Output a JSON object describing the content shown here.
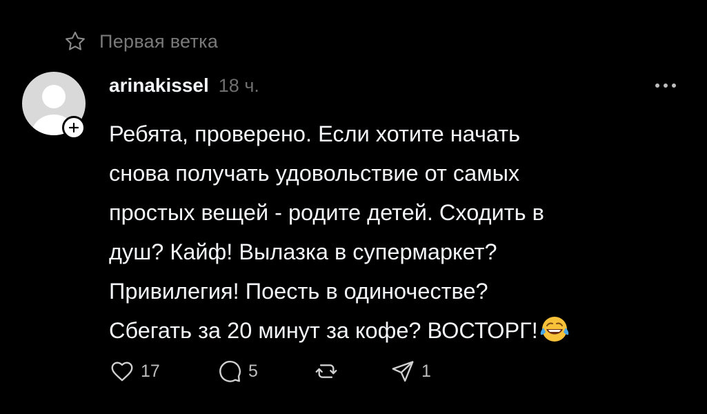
{
  "thread": {
    "title": "Первая ветка",
    "icon": "star-icon"
  },
  "post": {
    "username": "arinakissel",
    "time": "18 ч.",
    "lines": [
      "Ребята, проверено. Если хотите начать",
      "снова получать удовольствие от самых",
      "простых вещей - родите детей. Сходить в",
      "душ? Кайф! Вылазка в супермаркет?",
      "Привилегия! Поесть в одиночестве?",
      "Сбегать за 20 минут за кофе? ВОСТОРГ!"
    ],
    "emoji": "face-with-tears-of-joy"
  },
  "actions": {
    "likes": "17",
    "replies": "5",
    "shares": "1"
  },
  "colors": {
    "background": "#000000",
    "text": "#f3f5f7",
    "muted": "#7a7a7a",
    "icon": "#d0d0d0"
  }
}
